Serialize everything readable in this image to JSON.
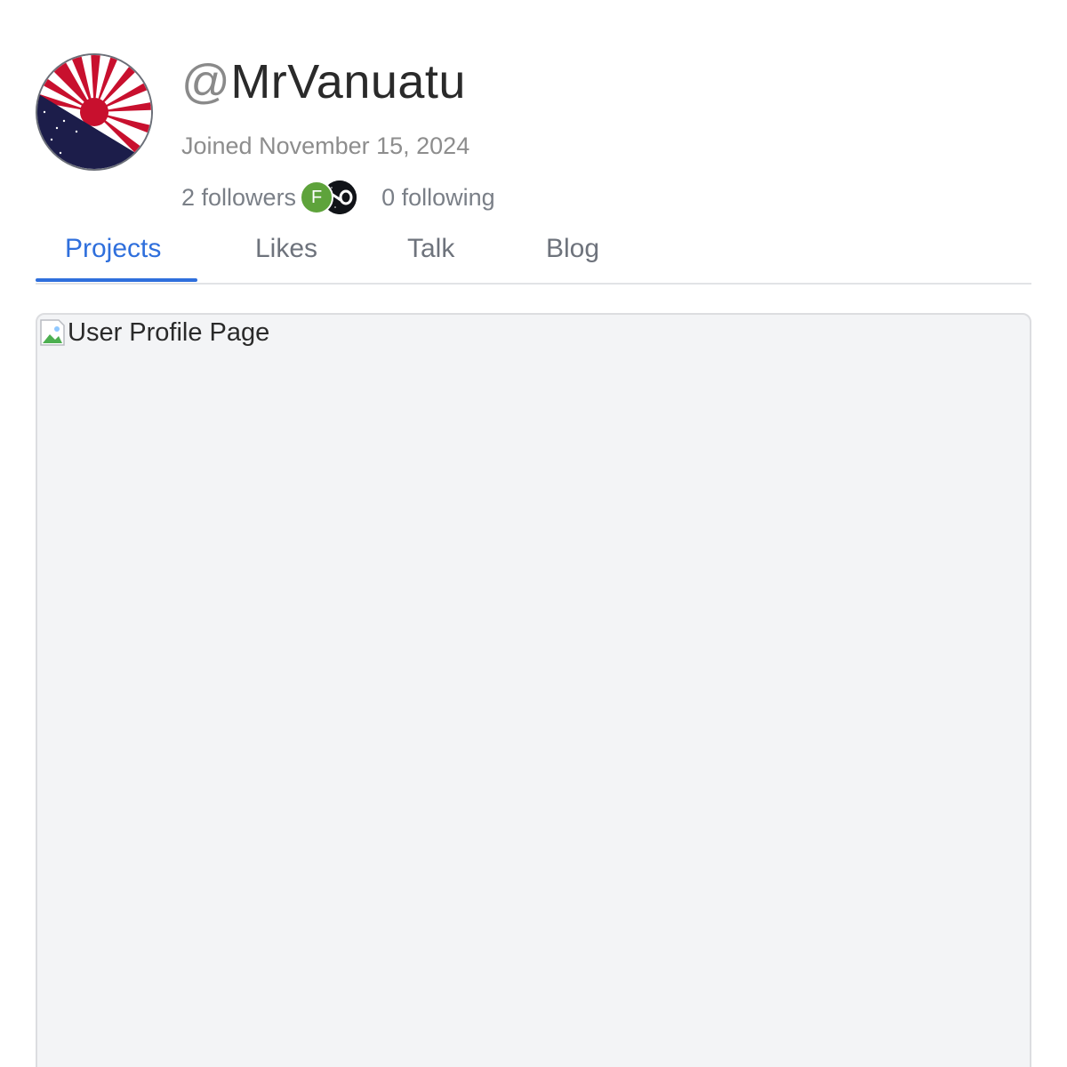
{
  "profile": {
    "at_symbol": "@",
    "username": "MrVanuatu",
    "joined": "Joined November 15, 2024",
    "followers": "2 followers",
    "following": "0 following",
    "follower_avatars": [
      {
        "initial": "F",
        "color": "#5ea33b"
      },
      {
        "initial": "",
        "color": "#111318"
      }
    ]
  },
  "tabs": [
    {
      "label": "Projects",
      "active": true
    },
    {
      "label": "Likes",
      "active": false
    },
    {
      "label": "Talk",
      "active": false
    },
    {
      "label": "Blog",
      "active": false
    }
  ],
  "content": {
    "image_alt": "User Profile Page"
  },
  "colors": {
    "accent": "#2f6fdc",
    "avatar_red": "#c8102e",
    "avatar_navy": "#1c1d4a"
  }
}
